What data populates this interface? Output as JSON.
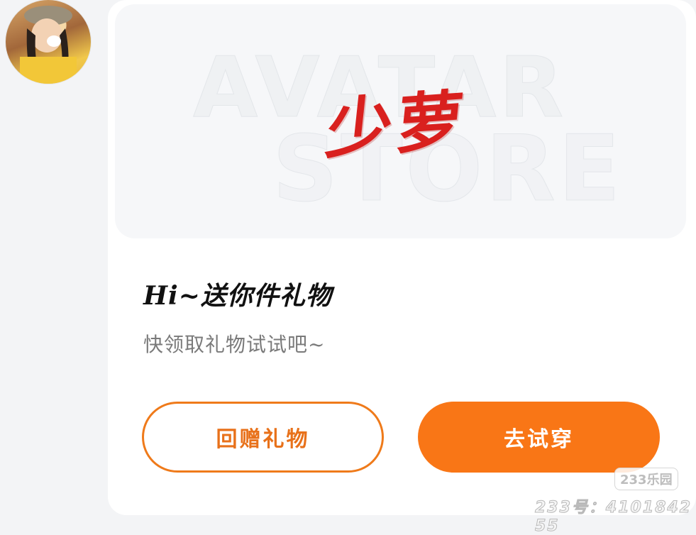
{
  "banner": {
    "watermark_line1": "AVATAR",
    "watermark_line2": "STORE",
    "calligraphy_text": "少萝"
  },
  "gift": {
    "title": "Hi~送你件礼物",
    "subtitle": "快领取礼物试试吧~"
  },
  "actions": {
    "return_gift_label": "回赠礼物",
    "try_on_label": "去试穿"
  },
  "watermark": {
    "brand": "233乐园",
    "id_text": "233号：4101842​55"
  },
  "colors": {
    "accent": "#f97616",
    "calligraphy": "#d9201e"
  }
}
